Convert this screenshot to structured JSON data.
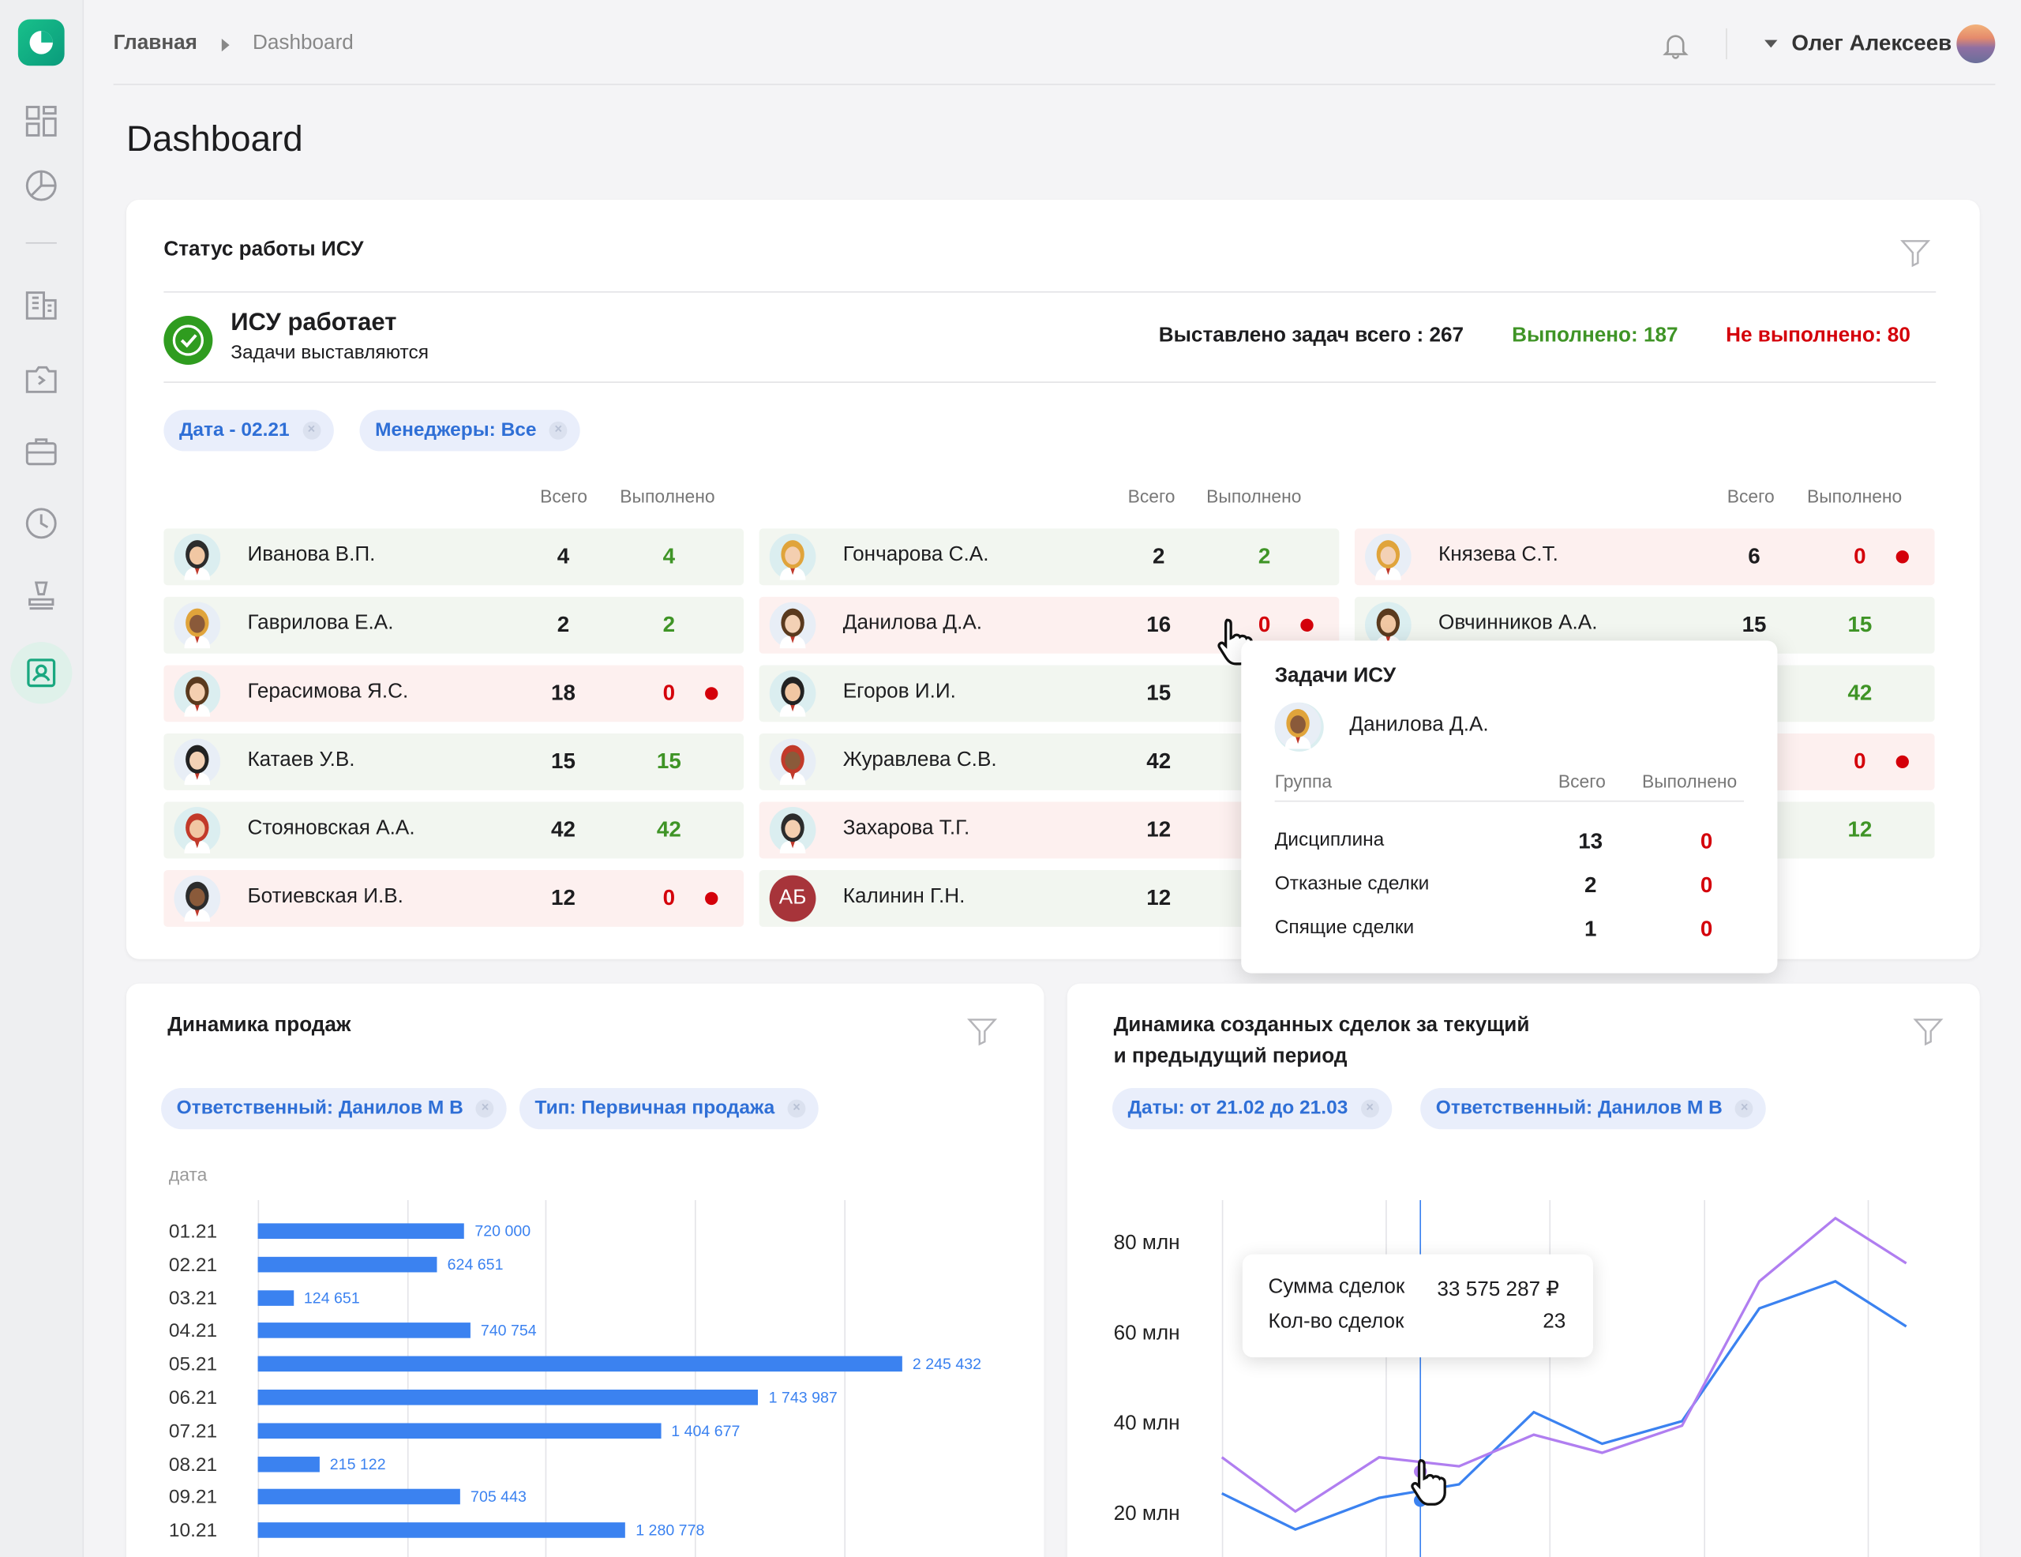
{
  "header": {
    "breadcrumb_home": "Главная",
    "breadcrumb_current": "Dashboard",
    "user_name": "Олег Алексеев",
    "page_title": "Dashboard"
  },
  "sidebar": {
    "icons": [
      "dashboard-icon",
      "pie-chart-icon",
      "building-icon",
      "folder-icon",
      "briefcase-icon",
      "clock-icon",
      "stamp-icon",
      "contact-card-icon"
    ],
    "active": "contact-card-icon"
  },
  "isu": {
    "title": "Статус работы ИСУ",
    "status_title": "ИСУ работает",
    "status_subtitle": "Задачи выставляются",
    "total_label": "Выставлено задач всего : 267",
    "done_label": "Выполнено: 187",
    "not_done_label": "Не выполнено: 80",
    "chips": [
      "Дата - 02.21",
      "Менеджеры: Все"
    ],
    "col_total": "Всего",
    "col_done": "Выполнено",
    "columns": [
      [
        {
          "name": "Иванова В.П.",
          "total": "4",
          "done": "4",
          "status": "green"
        },
        {
          "name": "Гаврилова Е.А.",
          "total": "2",
          "done": "2",
          "status": "green"
        },
        {
          "name": "Герасимова Я.С.",
          "total": "18",
          "done": "0",
          "status": "red"
        },
        {
          "name": "Катаев У.В.",
          "total": "15",
          "done": "15",
          "status": "green"
        },
        {
          "name": "Стояновская А.А.",
          "total": "42",
          "done": "42",
          "status": "green"
        },
        {
          "name": "Ботиевская И.В.",
          "total": "12",
          "done": "0",
          "status": "red"
        }
      ],
      [
        {
          "name": "Гончарова С.А.",
          "total": "2",
          "done": "2",
          "status": "green"
        },
        {
          "name": "Данилова Д.А.",
          "total": "16",
          "done": "0",
          "status": "red"
        },
        {
          "name": "Егоров И.И.",
          "total": "15",
          "done": "",
          "status": "green"
        },
        {
          "name": "Журавлева С.В.",
          "total": "42",
          "done": "",
          "status": "green"
        },
        {
          "name": "Захарова Т.Г.",
          "total": "12",
          "done": "",
          "status": "red"
        },
        {
          "name": "Калинин Г.Н.",
          "total": "12",
          "done": "",
          "status": "green",
          "initials": "АБ"
        }
      ],
      [
        {
          "name": "Князева С.Т.",
          "total": "6",
          "done": "0",
          "status": "red"
        },
        {
          "name": "Овчинников А.А.",
          "total": "15",
          "done": "15",
          "status": "green"
        },
        {
          "name": "",
          "total": "",
          "done": "42",
          "status": "green"
        },
        {
          "name": "",
          "total": "",
          "done": "0",
          "status": "red"
        },
        {
          "name": "",
          "total": "",
          "done": "12",
          "status": "green"
        }
      ]
    ],
    "popup": {
      "title": "Задачи ИСУ",
      "person": "Данилова Д.А.",
      "col_group": "Группа",
      "col_total": "Всего",
      "col_done": "Выполнено",
      "rows": [
        {
          "group": "Дисциплина",
          "total": "13",
          "done": "0"
        },
        {
          "group": "Отказные сделки",
          "total": "2",
          "done": "0"
        },
        {
          "group": "Спящие сделки",
          "total": "1",
          "done": "0"
        }
      ]
    }
  },
  "sales": {
    "title": "Динамика продаж",
    "chips": [
      "Ответственный:  Данилов М В",
      "Тип: Первичная продажа"
    ],
    "chart_data": {
      "type": "bar",
      "orientation": "horizontal",
      "ylabel": "дата",
      "categories": [
        "01.21",
        "02.21",
        "03.21",
        "04.21",
        "05.21",
        "06.21",
        "07.21",
        "08.21",
        "09.21",
        "10.21"
      ],
      "values": [
        720000,
        624651,
        124651,
        740754,
        2245432,
        1743987,
        1404677,
        215122,
        705443,
        1280778
      ],
      "value_labels": [
        "720 000",
        "624 651",
        "124 651",
        "740 754",
        "2 245 432",
        "1 743 987",
        "1 404 677",
        "215 122",
        "705 443",
        "1 280 778"
      ],
      "color": "#3b82f0"
    }
  },
  "deals": {
    "title_line1": "Динамика созданных сделок за текущий",
    "title_line2": "и предыдущий период",
    "chips": [
      "Даты: от 21.02 до 21.03",
      "Ответственный:  Данилов М В"
    ],
    "tooltip": {
      "sum_label": "Сумма сделок",
      "sum_value": "33 575 287 ₽",
      "count_label": "Кол-во сделок",
      "count_value": "23"
    },
    "chart_data": {
      "type": "line",
      "y_ticks": [
        "80 млн",
        "60 млн",
        "40 млн",
        "20 млн"
      ],
      "y_tick_values": [
        80,
        60,
        40,
        20
      ],
      "x": [
        1,
        2,
        3,
        4,
        5,
        6,
        7,
        8,
        9,
        10,
        11
      ],
      "series": [
        {
          "color": "#3b82f0",
          "values": [
            25,
            17,
            24,
            27,
            43,
            36,
            41,
            66,
            72,
            62
          ]
        },
        {
          "color": "#b07ef0",
          "values": [
            33,
            21,
            33,
            31,
            38,
            34,
            40,
            72,
            86,
            76
          ]
        }
      ],
      "highlight_index": 3
    }
  }
}
